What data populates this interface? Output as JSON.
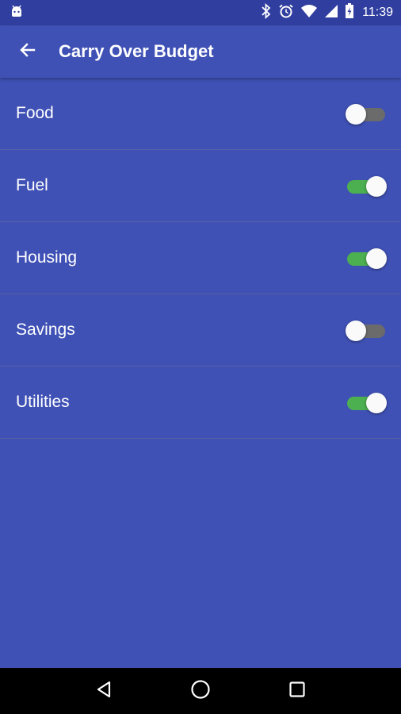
{
  "status_bar": {
    "time": "11:39",
    "icons": [
      "android-notification-icon",
      "bluetooth-icon",
      "alarm-icon",
      "wifi-icon",
      "signal-icon",
      "battery-charging-icon"
    ]
  },
  "app_bar": {
    "title": "Carry Over Budget",
    "back_icon": "arrow-back-icon"
  },
  "categories": [
    {
      "label": "Food",
      "enabled": false
    },
    {
      "label": "Fuel",
      "enabled": true
    },
    {
      "label": "Housing",
      "enabled": true
    },
    {
      "label": "Savings",
      "enabled": false
    },
    {
      "label": "Utilities",
      "enabled": true
    }
  ],
  "nav_bar": {
    "icons": [
      "back-triangle-icon",
      "home-circle-icon",
      "recents-square-icon"
    ]
  },
  "colors": {
    "primary": "#3f51b5",
    "primary_dark": "#303f9f",
    "switch_on": "#4caf50",
    "switch_off": "#6b6b6b"
  }
}
